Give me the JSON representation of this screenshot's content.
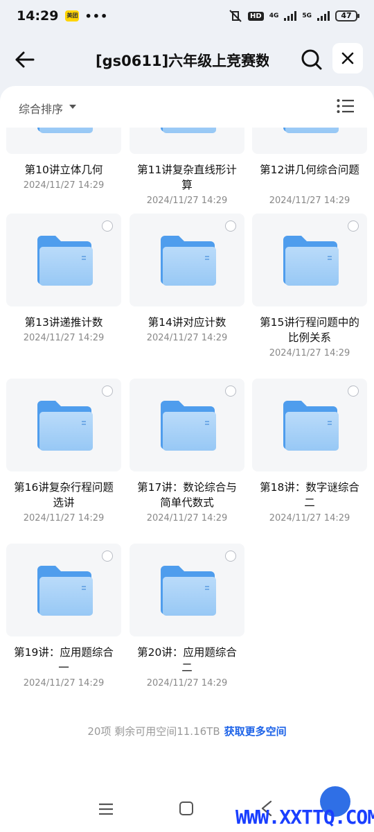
{
  "status_bar": {
    "time": "14:29",
    "app_badge": "美团",
    "dots": "•••",
    "hd": "HD",
    "net1": "4G",
    "net2": "5G",
    "battery": "47"
  },
  "header": {
    "title": "[gs0611]六年级上竞赛数..."
  },
  "sort": {
    "label": "综合排序"
  },
  "folders": [
    {
      "name": "第10讲立体几何",
      "date": "2024/11/27 14:29"
    },
    {
      "name": "第11讲复杂直线形计算",
      "date": "2024/11/27 14:29"
    },
    {
      "name": "第12讲几何综合问题",
      "date": "2024/11/27 14:29"
    },
    {
      "name": "第13讲递推计数",
      "date": "2024/11/27 14:29"
    },
    {
      "name": "第14讲对应计数",
      "date": "2024/11/27 14:29"
    },
    {
      "name": "第15讲行程问题中的比例关系",
      "date": "2024/11/27 14:29"
    },
    {
      "name": "第16讲复杂行程问题选讲",
      "date": "2024/11/27 14:29"
    },
    {
      "name": "第17讲：数论综合与简单代数式",
      "date": "2024/11/27 14:29"
    },
    {
      "name": "第18讲：数字谜综合二",
      "date": "2024/11/27 14:29"
    },
    {
      "name": "第19讲：应用题综合一",
      "date": "2024/11/27 14:29"
    },
    {
      "name": "第20讲：应用题综合二",
      "date": "2024/11/27 14:29"
    }
  ],
  "footer": {
    "summary": "20项 剩余可用空间11.16TB",
    "link": "获取更多空间"
  },
  "watermark": "WWW.XXTTQ.COM",
  "colors": {
    "accent": "#1d63e8",
    "folder": "#5aa9f0",
    "panel_bg": "#ffffff",
    "page_bg": "#eef1f6"
  }
}
